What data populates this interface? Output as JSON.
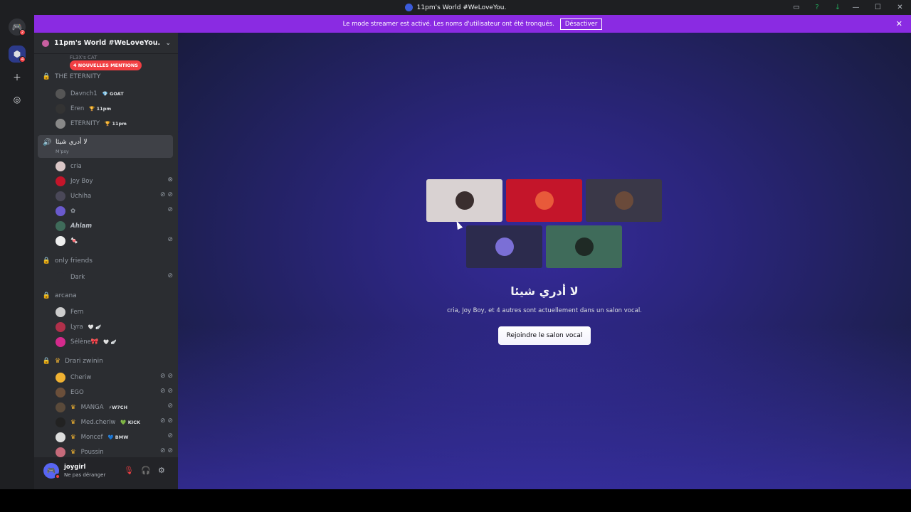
{
  "window": {
    "title": "11pm's World #WeLoveYou."
  },
  "rail": {
    "dm_badge": "2",
    "server_badge": "4"
  },
  "banner": {
    "text": "Le mode streamer est activé. Les noms d'utilisateur ont été tronqués.",
    "button": "Désactiver"
  },
  "server": {
    "name": "11pm's World #WeLoveYou."
  },
  "mentions": "4 NOUVELLES MENTIONS",
  "ghost_channel": "FL3X's CAT",
  "categories": [
    {
      "name": "THE ETERNITY"
    },
    {
      "name": "only friends"
    },
    {
      "name": "arcana"
    },
    {
      "name": "Drari zwinin"
    }
  ],
  "users_eternity": [
    {
      "name": "Davnch1",
      "tag": "💎 GOAT"
    },
    {
      "name": "Eren",
      "tag": "🏆 11pm"
    },
    {
      "name": "ETERNITY",
      "tag": "🏆 11pm"
    }
  ],
  "active_channel": {
    "name": "لا أدري شيئا",
    "sub": "M'psy"
  },
  "users_voice": [
    {
      "name": "cria"
    },
    {
      "name": "Joy Boy"
    },
    {
      "name": "Uchiha"
    },
    {
      "name": "✿"
    },
    {
      "name": "Ahlam"
    },
    {
      "name": "🍬"
    }
  ],
  "users_friends": [
    {
      "name": "Dark"
    }
  ],
  "users_arcana": [
    {
      "name": "Fern"
    },
    {
      "name": "Lyra",
      "tag": "🤍 🪽"
    },
    {
      "name": "Sélène🎀",
      "tag": "🤍 🪽"
    }
  ],
  "users_drari": [
    {
      "name": "Cheriw"
    },
    {
      "name": "EGO"
    },
    {
      "name": "MANGA",
      "tag": "⚡W7CH"
    },
    {
      "name": "Med.cheriw",
      "tag": "💚 KICK"
    },
    {
      "name": "Moncef",
      "tag": "💙 BMW"
    },
    {
      "name": "Poussin"
    }
  ],
  "user_panel": {
    "name": "joygirl",
    "status": "Ne pas déranger"
  },
  "voice": {
    "channel_name": "لا أدري شيئا",
    "description": "cria, Joy Boy, et 4 autres sont actuellement dans un salon vocal.",
    "join_button": "Rejoindre le salon vocal"
  },
  "colors": {
    "banner": "#8a2be2",
    "accent": "#5865f2",
    "tile1": "#d9d2d2",
    "tile2": "#c4152a",
    "tile3": "#3a3848",
    "tile4": "#2c2b4d",
    "tile5": "#3f6b5a"
  }
}
